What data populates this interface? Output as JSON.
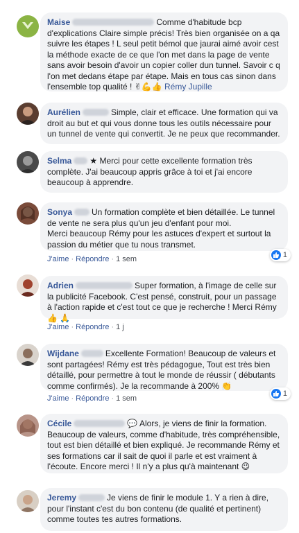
{
  "comments": [
    {
      "name": "Maise",
      "text": "Comme d'habitude bcp d'explications Claire simple précis! Très bien organisée on a qa suivre les étapes ! L seul petit bémol que jaurai aimé avoir cest la méthode exacte de ce que l'on met dans la page de vente sans avoir besoin d'avoir un copier coller dun tunnel. Savoir c q l'on met dedans étape par étape. Mais en tous cas sinon dans l'ensemble top qualité ! ",
      "emojis": "✌💪👍",
      "tag": "Rémy Jupille"
    },
    {
      "name": "Aurélien",
      "text": "Simple, clair et efficace. Une formation qui va droit au but et qui vous donne tous les outils nécessaire pour un tunnel de vente qui convertit. Je ne peux que recommander."
    },
    {
      "name": "Selma",
      "text": "★ Merci pour cette excellente formation très complète. J'ai beaucoup appris grâce à toi et j'ai encore beaucoup à apprendre."
    },
    {
      "name": "Sonya",
      "text": "Un formation complète et bien détaillée. Le tunnel de vente ne sera plus qu'un jeu d'enfant pour moi.",
      "text2": "Merci beaucoup Rémy pour les astuces d'expert et surtout la passion du métier que tu nous transmet.",
      "like": "J'aime",
      "reply": "Répondre",
      "time": "1 sem",
      "reactions": "1"
    },
    {
      "name": "Adrien",
      "text": "Super formation, à l'image de celle sur la publicité Facebook. C'est pensé, construit, pour un passage à l'action rapide et c'est tout ce que je recherche ! Merci Rémy 👍 🙏",
      "like": "J'aime",
      "reply": "Répondre",
      "time": "1 j"
    },
    {
      "name": "Wijdane",
      "text": "Excellente Formation! Beaucoup de valeurs et sont partagées! Rémy est très pédagogue, Tout est très bien détaillé, pour permettre à tout le monde de réussir ( débutants comme confirmés). Je la recommande à 200% 👏",
      "like": "J'aime",
      "reply": "Répondre",
      "time": "1 sem",
      "reactions": "1"
    },
    {
      "name": "Cécile",
      "text": "💬 Alors, je viens de finir la formation. Beaucoup de valeurs, comme d'habitude, très compréhensible, tout est bien détaillé et bien expliqué. Je recommande Rémy et ses formations car il sait de quoi il parle et est vraiment à l'écoute. Encore merci ! Il n'y a plus qu'à maintenant 😉"
    },
    {
      "name": "Jeremy",
      "text": "Je viens de finir le module 1. Y a rien à dire, pour l'instant c'est du bon contenu (de qualité et pertinent) comme toutes tes autres formations."
    }
  ],
  "colors": {
    "bubble": "#f2f3f5",
    "name": "#385898",
    "like_blue": "#1877f2"
  }
}
